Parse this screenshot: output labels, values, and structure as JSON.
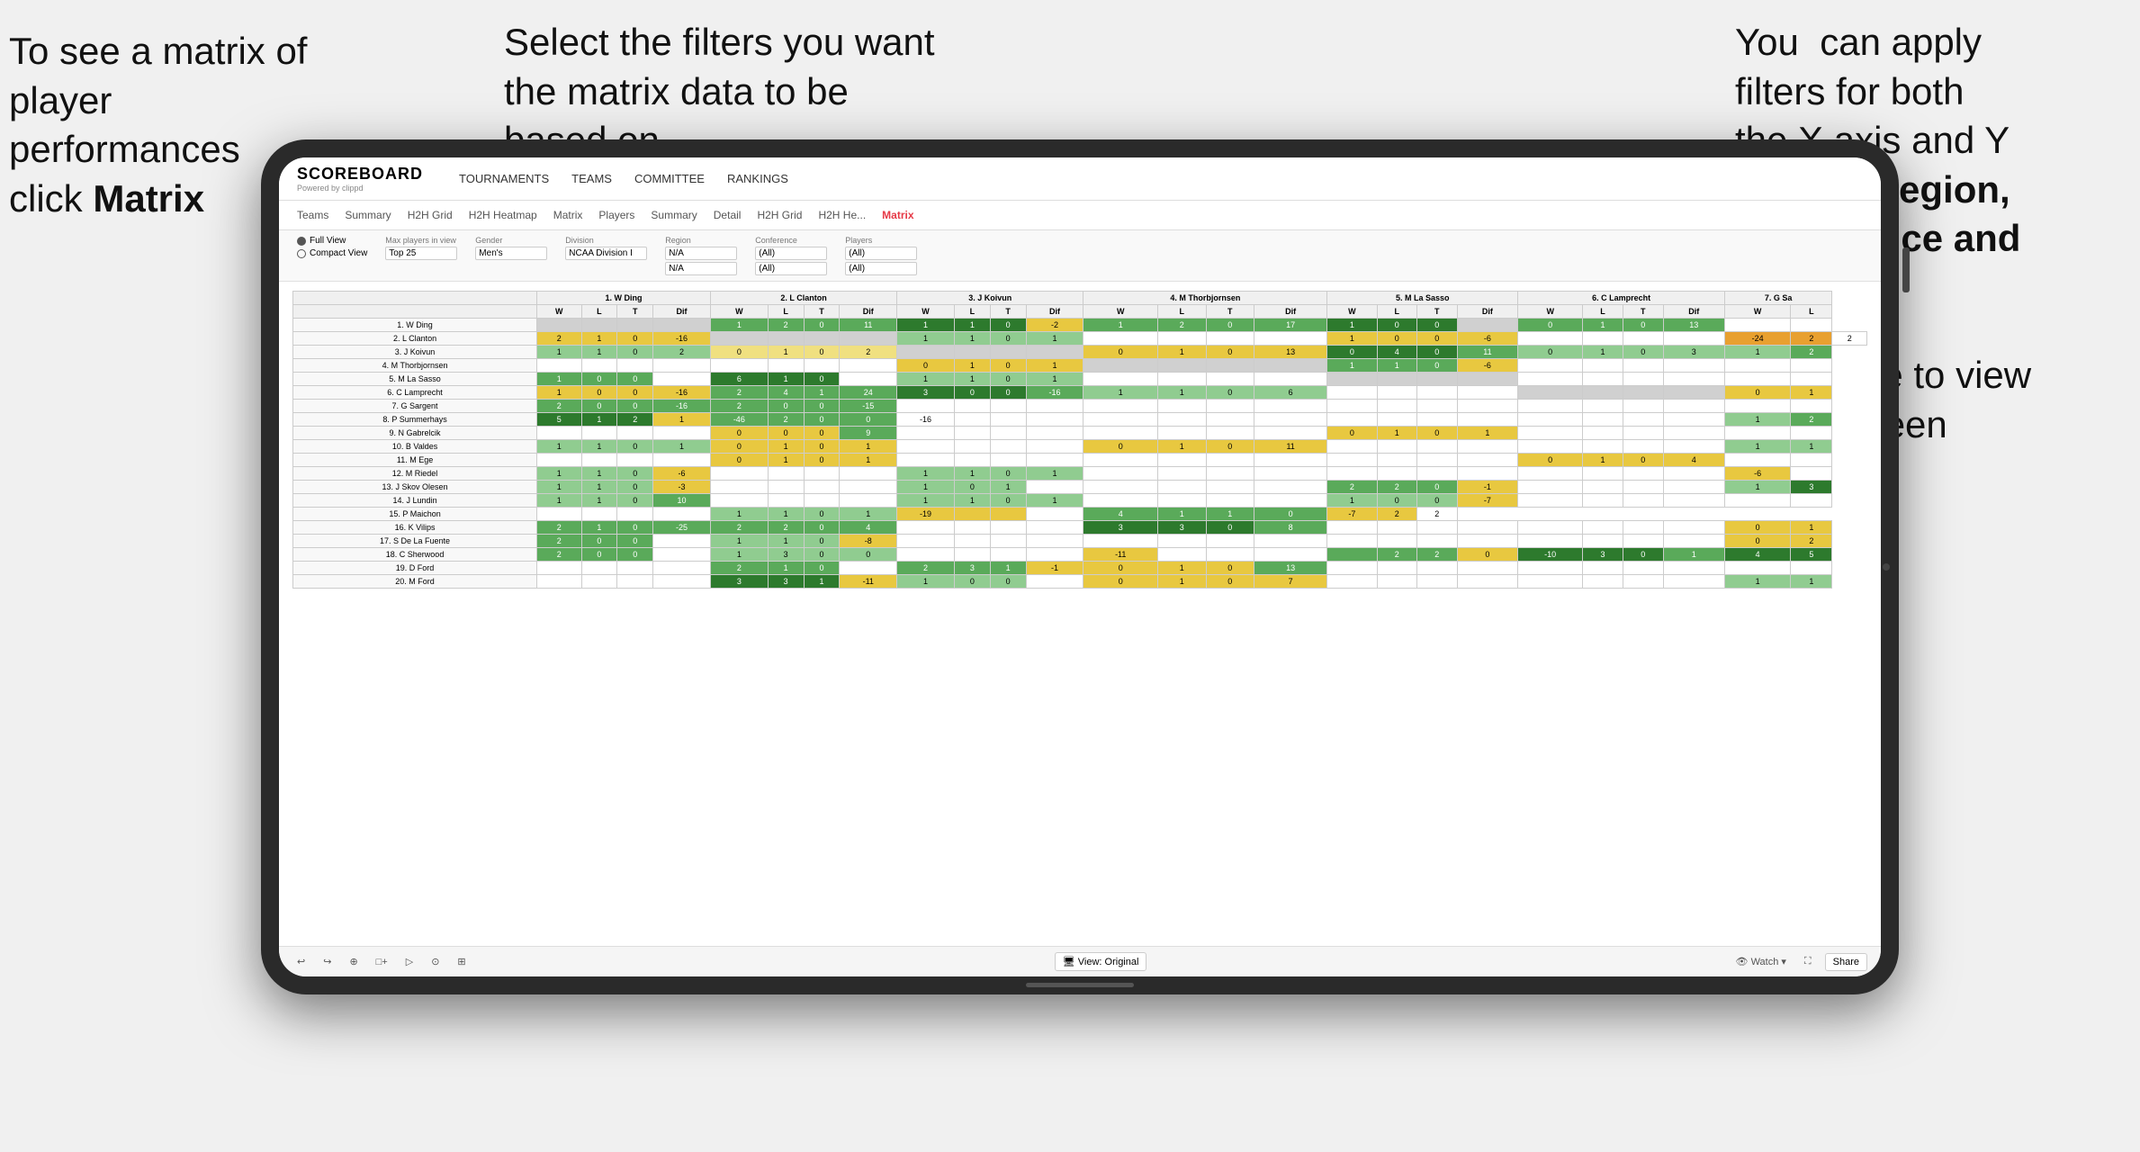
{
  "annotations": {
    "left": {
      "line1": "To see a matrix of",
      "line2": "player performances",
      "line3": "click ",
      "bold": "Matrix"
    },
    "center": {
      "text": "Select the filters you want the matrix data to be based on"
    },
    "right": {
      "line1": "You  can apply filters for both the X axis and Y Axis for ",
      "bold": "Region, Conference and Team"
    },
    "bottom_right": {
      "text": "Click here to view in full screen"
    }
  },
  "nav": {
    "logo": "SCOREBOARD",
    "logo_sub": "Powered by clippd",
    "links": [
      "TOURNAMENTS",
      "TEAMS",
      "COMMITTEE",
      "RANKINGS"
    ]
  },
  "sub_nav": {
    "items": [
      "Teams",
      "Summary",
      "H2H Grid",
      "H2H Heatmap",
      "Matrix",
      "Players",
      "Summary",
      "Detail",
      "H2H Grid",
      "H2H He...",
      "Matrix"
    ],
    "active": "Matrix"
  },
  "filters": {
    "view_full": "Full View",
    "view_compact": "Compact View",
    "max_players_label": "Max players in view",
    "max_players_value": "Top 25",
    "gender_label": "Gender",
    "gender_value": "Men's",
    "division_label": "Division",
    "division_value": "NCAA Division I",
    "region_label": "Region",
    "region_value1": "N/A",
    "region_value2": "N/A",
    "conference_label": "Conference",
    "conference_value1": "(All)",
    "conference_value2": "(All)",
    "players_label": "Players",
    "players_value1": "(All)",
    "players_value2": "(All)"
  },
  "col_headers": [
    "1. W Ding",
    "2. L Clanton",
    "3. J Koivun",
    "4. M Thorbjornsen",
    "5. M La Sasso",
    "6. C Lamprecht",
    "7. G Sa"
  ],
  "sub_col_headers": [
    "W",
    "L",
    "T",
    "Dif"
  ],
  "rows": [
    {
      "label": "1. W Ding",
      "cells": [
        "",
        "",
        "",
        "",
        "1",
        "2",
        "0",
        "11",
        "1",
        "1",
        "0",
        "-2",
        "1",
        "2",
        "0",
        "17",
        "1",
        "0",
        "0",
        "",
        "0",
        "1",
        "0",
        "13",
        "",
        ""
      ]
    },
    {
      "label": "2. L Clanton",
      "cells": [
        "2",
        "1",
        "0",
        "-16",
        "",
        "",
        "",
        "",
        "1",
        "1",
        "0",
        "1",
        "",
        "",
        "",
        "",
        "1",
        "0",
        "0",
        "-6",
        "",
        "",
        "",
        "",
        "-24",
        "2",
        "2"
      ]
    },
    {
      "label": "3. J Koivun",
      "cells": [
        "1",
        "1",
        "0",
        "2",
        "0",
        "1",
        "0",
        "2",
        "",
        "",
        "",
        "",
        "0",
        "1",
        "0",
        "13",
        "0",
        "4",
        "0",
        "11",
        "0",
        "1",
        "0",
        "3",
        "1",
        "2"
      ]
    },
    {
      "label": "4. M Thorbjornsen",
      "cells": [
        "",
        "",
        "",
        "",
        "",
        "",
        "",
        "",
        "0",
        "1",
        "0",
        "1",
        "",
        "",
        "",
        "",
        "1",
        "1",
        "0",
        "-6",
        "",
        "",
        "",
        "",
        "",
        ""
      ]
    },
    {
      "label": "5. M La Sasso",
      "cells": [
        "1",
        "0",
        "0",
        "",
        "6",
        "1",
        "0",
        "",
        "1",
        "1",
        "0",
        "1",
        "",
        "",
        "",
        "",
        "",
        "",
        "",
        "",
        "",
        "",
        "",
        "",
        "",
        ""
      ]
    },
    {
      "label": "6. C Lamprecht",
      "cells": [
        "1",
        "0",
        "0",
        "-16",
        "2",
        "4",
        "1",
        "24",
        "3",
        "0",
        "0",
        "-16",
        "1",
        "1",
        "0",
        "6",
        "",
        "",
        "",
        "",
        "",
        "",
        "",
        "",
        "0",
        "1"
      ]
    },
    {
      "label": "7. G Sargent",
      "cells": [
        "2",
        "0",
        "0",
        "-16",
        "2",
        "0",
        "0",
        "-15",
        "",
        "",
        "",
        "",
        "",
        "",
        "",
        "",
        "",
        "",
        "",
        "",
        "",
        "",
        "",
        "",
        "",
        ""
      ]
    },
    {
      "label": "8. P Summerhays",
      "cells": [
        "5",
        "1",
        "2",
        "1",
        "-46",
        "2",
        "0",
        "0",
        "-16",
        "",
        "",
        "",
        "",
        "",
        "",
        "",
        "",
        "",
        "",
        "",
        "",
        "",
        "",
        "",
        "1",
        "2"
      ]
    },
    {
      "label": "9. N Gabrelcik",
      "cells": [
        "",
        "",
        "",
        "",
        "0",
        "0",
        "0",
        "9",
        "",
        "",
        "",
        "",
        "",
        "",
        "",
        "",
        "0",
        "1",
        "0",
        "1",
        "",
        "",
        "",
        "",
        "",
        ""
      ]
    },
    {
      "label": "10. B Valdes",
      "cells": [
        "1",
        "1",
        "0",
        "1",
        "0",
        "1",
        "0",
        "1",
        "",
        "",
        "",
        "",
        "0",
        "1",
        "0",
        "11",
        "",
        "",
        "",
        "",
        "",
        "",
        "",
        "",
        "1",
        "1"
      ]
    },
    {
      "label": "11. M Ege",
      "cells": [
        "",
        "",
        "",
        "",
        "0",
        "1",
        "0",
        "1",
        "",
        "",
        "",
        "",
        "",
        "",
        "",
        "",
        "",
        "",
        "",
        "",
        "0",
        "1",
        "0",
        "4",
        "",
        ""
      ]
    },
    {
      "label": "12. M Riedel",
      "cells": [
        "1",
        "1",
        "0",
        "-6",
        "",
        "",
        "",
        "",
        "1",
        "1",
        "0",
        "1",
        "",
        "",
        "",
        "",
        "",
        "",
        "",
        "",
        "",
        "",
        "",
        "",
        "-6",
        ""
      ]
    },
    {
      "label": "13. J Skov Olesen",
      "cells": [
        "1",
        "1",
        "0",
        "-3",
        "",
        "",
        "",
        "",
        "1",
        "0",
        "1",
        "",
        "",
        "",
        "",
        "",
        "2",
        "2",
        "0",
        "-1",
        "",
        "",
        "",
        "",
        "1",
        "3"
      ]
    },
    {
      "label": "14. J Lundin",
      "cells": [
        "1",
        "1",
        "0",
        "10",
        "",
        "",
        "",
        "",
        "1",
        "1",
        "0",
        "1",
        "",
        "",
        "",
        "",
        "1",
        "0",
        "0",
        "-7",
        "",
        "",
        "",
        "",
        "",
        ""
      ]
    },
    {
      "label": "15. P Maichon",
      "cells": [
        "",
        "",
        "",
        "",
        "1",
        "1",
        "0",
        "1",
        "-19",
        "",
        "",
        "",
        "4",
        "1",
        "1",
        "0",
        "-7",
        "2",
        "2"
      ]
    },
    {
      "label": "16. K Vilips",
      "cells": [
        "2",
        "1",
        "0",
        "-25",
        "2",
        "2",
        "0",
        "4",
        "",
        "",
        "",
        "",
        "3",
        "3",
        "0",
        "8",
        "",
        "",
        "",
        "",
        "",
        "",
        "",
        "",
        "0",
        "1"
      ]
    },
    {
      "label": "17. S De La Fuente",
      "cells": [
        "2",
        "0",
        "0",
        "",
        "1",
        "1",
        "0",
        "-8",
        "",
        "",
        "",
        "",
        "",
        "",
        "",
        "",
        "",
        "",
        "",
        "",
        "",
        "",
        "",
        "",
        "0",
        "2"
      ]
    },
    {
      "label": "18. C Sherwood",
      "cells": [
        "2",
        "0",
        "0",
        "",
        "1",
        "3",
        "0",
        "0",
        "",
        "",
        "",
        "",
        "-11",
        "",
        "",
        "",
        "",
        "2",
        "2",
        "0",
        "-10",
        "3",
        "0",
        "1",
        "4",
        "5"
      ]
    },
    {
      "label": "19. D Ford",
      "cells": [
        "",
        "",
        "",
        "",
        "2",
        "1",
        "0",
        "",
        "2",
        "3",
        "1",
        "-1",
        "0",
        "1",
        "0",
        "13",
        "",
        "",
        "",
        "",
        "",
        "",
        "",
        "",
        "",
        ""
      ]
    },
    {
      "label": "20. M Ford",
      "cells": [
        "",
        "",
        "",
        "",
        "3",
        "3",
        "1",
        "-11",
        "1",
        "0",
        "0",
        "",
        "0",
        "1",
        "0",
        "7",
        "",
        "",
        "",
        "",
        "",
        "",
        "",
        "",
        "1",
        "1"
      ]
    }
  ],
  "toolbar": {
    "buttons": [
      "↩",
      "↪",
      "⊕",
      "□+",
      "▷",
      "⊙",
      "⊞"
    ],
    "view_original": "🖥 View: Original",
    "watch": "👁 Watch ▾",
    "share": "Share"
  }
}
